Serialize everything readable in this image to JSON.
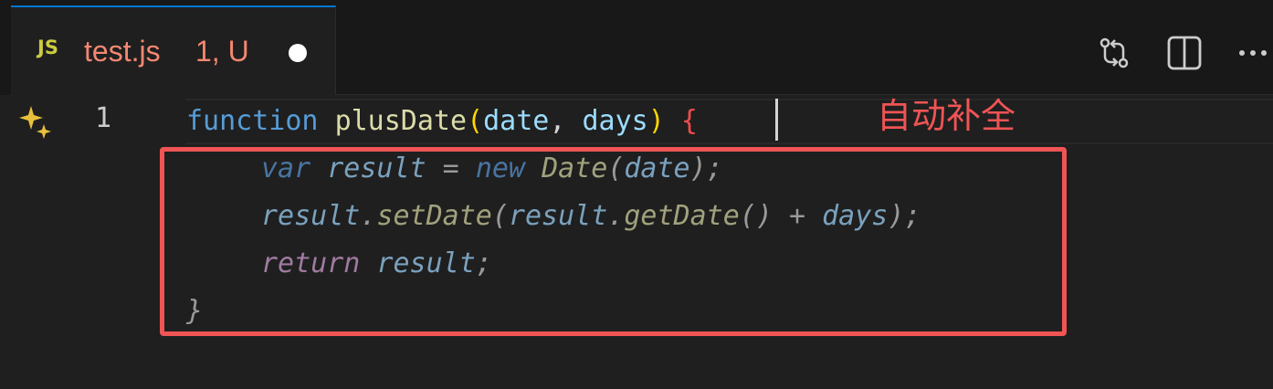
{
  "tab": {
    "icon_text": "JS",
    "title": "test.js",
    "status": "1, U"
  },
  "actions": [
    {
      "name": "open-changes",
      "icon": "git-compare-icon"
    },
    {
      "name": "split-editor",
      "icon": "split-editor-icon"
    },
    {
      "name": "more-actions",
      "icon": "ellipsis-icon"
    }
  ],
  "editor": {
    "line_number": "1",
    "code_line1": {
      "keyword": "function",
      "name": "plusDate",
      "open_paren": "(",
      "param1": "date",
      "comma": ", ",
      "param2": "days",
      "close_paren": ")",
      "brace": "{"
    },
    "suggestion": {
      "line1": {
        "kw": "var",
        "v": "result",
        "op": " = ",
        "kw2": "new",
        "fn": "Date",
        "p": "(",
        "arg": "date",
        "end": ");"
      },
      "line2": {
        "v": "result",
        "dot": ".",
        "fn": "setDate",
        "p": "(",
        "v2": "result",
        "dot2": ".",
        "fn2": "getDate",
        "p2": "() + ",
        "arg": "days",
        "end": ");"
      },
      "line3": {
        "kw": "return",
        "v": "result",
        "end": ";"
      },
      "line4": {
        "brace": "}"
      }
    }
  },
  "annotation": "自动补全",
  "colors": {
    "accent": "#0078d4",
    "modified_tab": "#f48771",
    "annotation": "#f05454",
    "js_icon": "#cbcb41"
  }
}
